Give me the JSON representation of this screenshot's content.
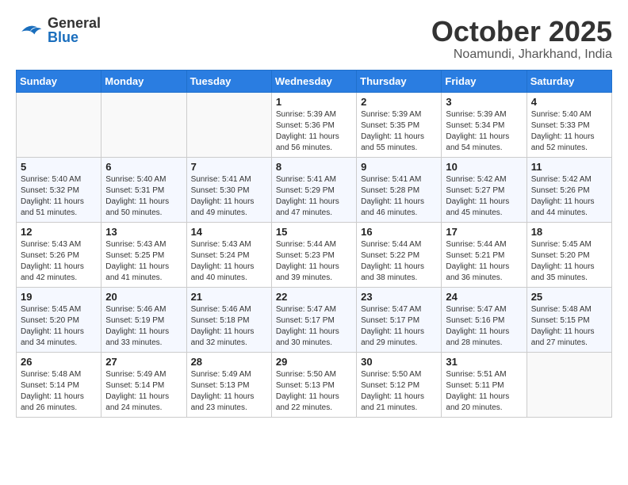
{
  "header": {
    "logo_general": "General",
    "logo_blue": "Blue",
    "month_title": "October 2025",
    "location": "Noamundi, Jharkhand, India"
  },
  "weekdays": [
    "Sunday",
    "Monday",
    "Tuesday",
    "Wednesday",
    "Thursday",
    "Friday",
    "Saturday"
  ],
  "weeks": [
    [
      {
        "day": "",
        "sunrise": "",
        "sunset": "",
        "daylight": ""
      },
      {
        "day": "",
        "sunrise": "",
        "sunset": "",
        "daylight": ""
      },
      {
        "day": "",
        "sunrise": "",
        "sunset": "",
        "daylight": ""
      },
      {
        "day": "1",
        "sunrise": "Sunrise: 5:39 AM",
        "sunset": "Sunset: 5:36 PM",
        "daylight": "Daylight: 11 hours and 56 minutes."
      },
      {
        "day": "2",
        "sunrise": "Sunrise: 5:39 AM",
        "sunset": "Sunset: 5:35 PM",
        "daylight": "Daylight: 11 hours and 55 minutes."
      },
      {
        "day": "3",
        "sunrise": "Sunrise: 5:39 AM",
        "sunset": "Sunset: 5:34 PM",
        "daylight": "Daylight: 11 hours and 54 minutes."
      },
      {
        "day": "4",
        "sunrise": "Sunrise: 5:40 AM",
        "sunset": "Sunset: 5:33 PM",
        "daylight": "Daylight: 11 hours and 52 minutes."
      }
    ],
    [
      {
        "day": "5",
        "sunrise": "Sunrise: 5:40 AM",
        "sunset": "Sunset: 5:32 PM",
        "daylight": "Daylight: 11 hours and 51 minutes."
      },
      {
        "day": "6",
        "sunrise": "Sunrise: 5:40 AM",
        "sunset": "Sunset: 5:31 PM",
        "daylight": "Daylight: 11 hours and 50 minutes."
      },
      {
        "day": "7",
        "sunrise": "Sunrise: 5:41 AM",
        "sunset": "Sunset: 5:30 PM",
        "daylight": "Daylight: 11 hours and 49 minutes."
      },
      {
        "day": "8",
        "sunrise": "Sunrise: 5:41 AM",
        "sunset": "Sunset: 5:29 PM",
        "daylight": "Daylight: 11 hours and 47 minutes."
      },
      {
        "day": "9",
        "sunrise": "Sunrise: 5:41 AM",
        "sunset": "Sunset: 5:28 PM",
        "daylight": "Daylight: 11 hours and 46 minutes."
      },
      {
        "day": "10",
        "sunrise": "Sunrise: 5:42 AM",
        "sunset": "Sunset: 5:27 PM",
        "daylight": "Daylight: 11 hours and 45 minutes."
      },
      {
        "day": "11",
        "sunrise": "Sunrise: 5:42 AM",
        "sunset": "Sunset: 5:26 PM",
        "daylight": "Daylight: 11 hours and 44 minutes."
      }
    ],
    [
      {
        "day": "12",
        "sunrise": "Sunrise: 5:43 AM",
        "sunset": "Sunset: 5:26 PM",
        "daylight": "Daylight: 11 hours and 42 minutes."
      },
      {
        "day": "13",
        "sunrise": "Sunrise: 5:43 AM",
        "sunset": "Sunset: 5:25 PM",
        "daylight": "Daylight: 11 hours and 41 minutes."
      },
      {
        "day": "14",
        "sunrise": "Sunrise: 5:43 AM",
        "sunset": "Sunset: 5:24 PM",
        "daylight": "Daylight: 11 hours and 40 minutes."
      },
      {
        "day": "15",
        "sunrise": "Sunrise: 5:44 AM",
        "sunset": "Sunset: 5:23 PM",
        "daylight": "Daylight: 11 hours and 39 minutes."
      },
      {
        "day": "16",
        "sunrise": "Sunrise: 5:44 AM",
        "sunset": "Sunset: 5:22 PM",
        "daylight": "Daylight: 11 hours and 38 minutes."
      },
      {
        "day": "17",
        "sunrise": "Sunrise: 5:44 AM",
        "sunset": "Sunset: 5:21 PM",
        "daylight": "Daylight: 11 hours and 36 minutes."
      },
      {
        "day": "18",
        "sunrise": "Sunrise: 5:45 AM",
        "sunset": "Sunset: 5:20 PM",
        "daylight": "Daylight: 11 hours and 35 minutes."
      }
    ],
    [
      {
        "day": "19",
        "sunrise": "Sunrise: 5:45 AM",
        "sunset": "Sunset: 5:20 PM",
        "daylight": "Daylight: 11 hours and 34 minutes."
      },
      {
        "day": "20",
        "sunrise": "Sunrise: 5:46 AM",
        "sunset": "Sunset: 5:19 PM",
        "daylight": "Daylight: 11 hours and 33 minutes."
      },
      {
        "day": "21",
        "sunrise": "Sunrise: 5:46 AM",
        "sunset": "Sunset: 5:18 PM",
        "daylight": "Daylight: 11 hours and 32 minutes."
      },
      {
        "day": "22",
        "sunrise": "Sunrise: 5:47 AM",
        "sunset": "Sunset: 5:17 PM",
        "daylight": "Daylight: 11 hours and 30 minutes."
      },
      {
        "day": "23",
        "sunrise": "Sunrise: 5:47 AM",
        "sunset": "Sunset: 5:17 PM",
        "daylight": "Daylight: 11 hours and 29 minutes."
      },
      {
        "day": "24",
        "sunrise": "Sunrise: 5:47 AM",
        "sunset": "Sunset: 5:16 PM",
        "daylight": "Daylight: 11 hours and 28 minutes."
      },
      {
        "day": "25",
        "sunrise": "Sunrise: 5:48 AM",
        "sunset": "Sunset: 5:15 PM",
        "daylight": "Daylight: 11 hours and 27 minutes."
      }
    ],
    [
      {
        "day": "26",
        "sunrise": "Sunrise: 5:48 AM",
        "sunset": "Sunset: 5:14 PM",
        "daylight": "Daylight: 11 hours and 26 minutes."
      },
      {
        "day": "27",
        "sunrise": "Sunrise: 5:49 AM",
        "sunset": "Sunset: 5:14 PM",
        "daylight": "Daylight: 11 hours and 24 minutes."
      },
      {
        "day": "28",
        "sunrise": "Sunrise: 5:49 AM",
        "sunset": "Sunset: 5:13 PM",
        "daylight": "Daylight: 11 hours and 23 minutes."
      },
      {
        "day": "29",
        "sunrise": "Sunrise: 5:50 AM",
        "sunset": "Sunset: 5:13 PM",
        "daylight": "Daylight: 11 hours and 22 minutes."
      },
      {
        "day": "30",
        "sunrise": "Sunrise: 5:50 AM",
        "sunset": "Sunset: 5:12 PM",
        "daylight": "Daylight: 11 hours and 21 minutes."
      },
      {
        "day": "31",
        "sunrise": "Sunrise: 5:51 AM",
        "sunset": "Sunset: 5:11 PM",
        "daylight": "Daylight: 11 hours and 20 minutes."
      },
      {
        "day": "",
        "sunrise": "",
        "sunset": "",
        "daylight": ""
      }
    ]
  ]
}
